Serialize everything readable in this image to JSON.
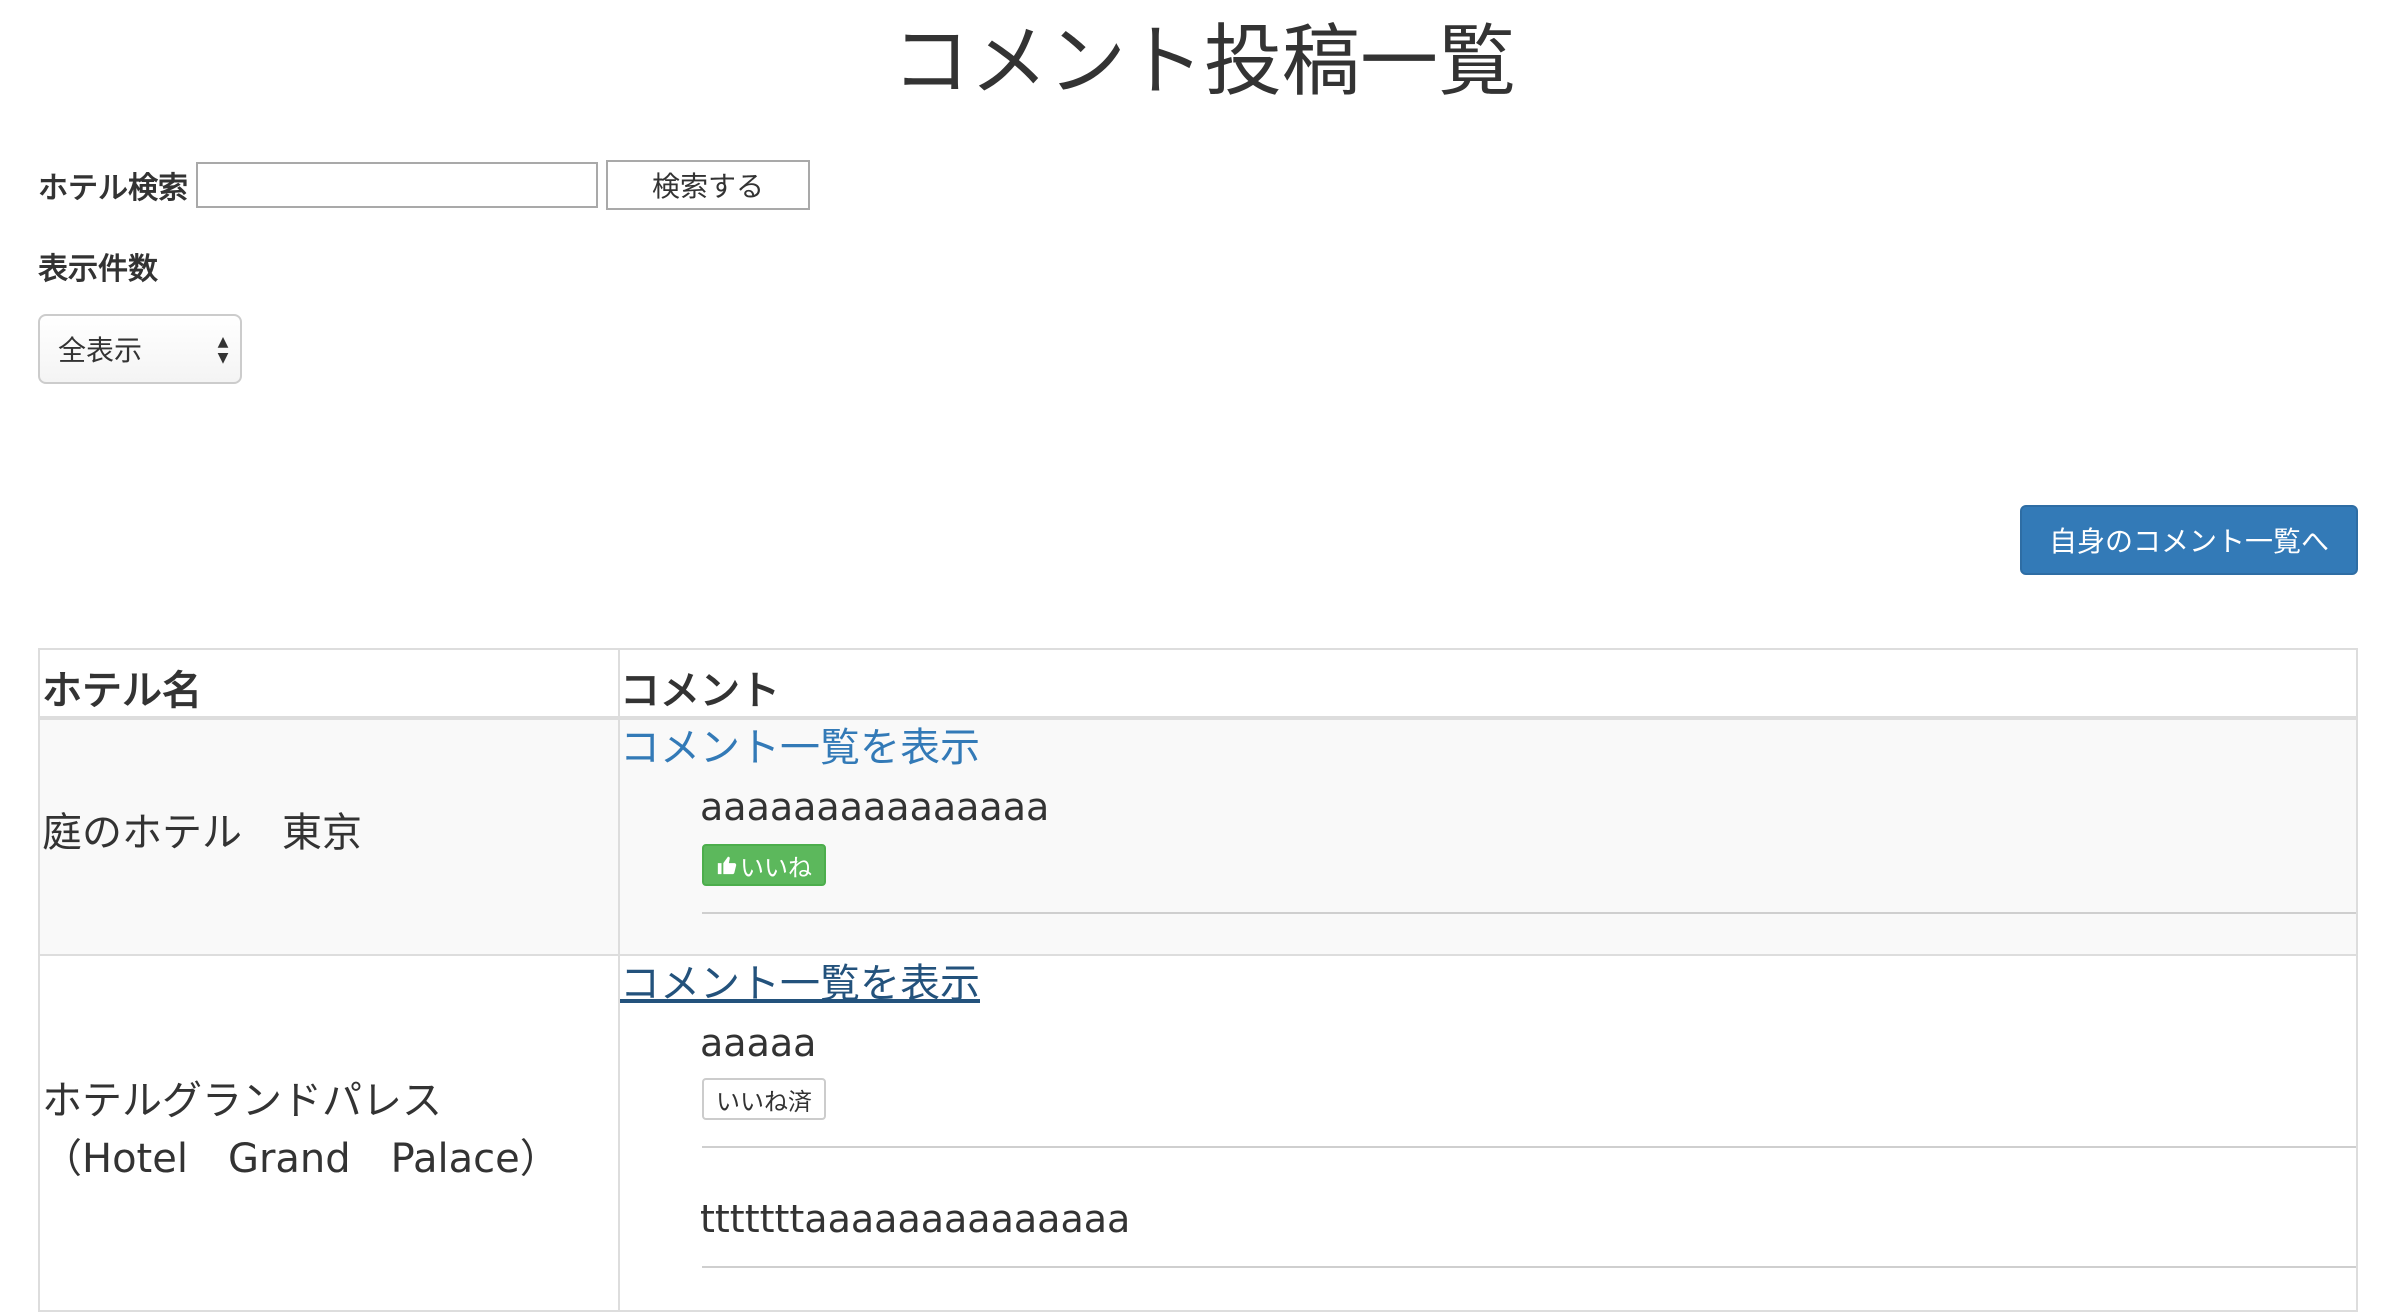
{
  "page": {
    "title": "コメント投稿一覧"
  },
  "search": {
    "label": "ホテル検索",
    "input_value": "",
    "placeholder": "",
    "button_label": "検索する"
  },
  "display_count": {
    "label": "表示件数",
    "selected": "全表示"
  },
  "my_comments_button": {
    "label": "自身のコメント一覧へ"
  },
  "colors": {
    "primary": "#337ab7",
    "success": "#5cb85c",
    "link_visited": "#23527c",
    "border": "#dddddd",
    "striped_row": "#f9f9f9"
  },
  "table": {
    "headers": {
      "hotel": "ホテル名",
      "comment": "コメント"
    },
    "rows": [
      {
        "hotel_name": "庭のホテル　東京",
        "link_label": "コメント一覧を表示",
        "comments": [
          {
            "text": "aaaaaaaaaaaaaaa",
            "like_label": "いいね",
            "like_icon": "thumbs-up-icon"
          }
        ]
      },
      {
        "hotel_name_line1": "ホテルグランドパレス",
        "hotel_name_line2": "（Hotel　Grand　Palace）",
        "link_label": "コメント一覧を表示",
        "comments": [
          {
            "text": "aaaaa",
            "like_label": "いいね済"
          },
          {
            "text": "tttttttaaaaaaaaaaaaaa"
          }
        ]
      }
    ]
  }
}
